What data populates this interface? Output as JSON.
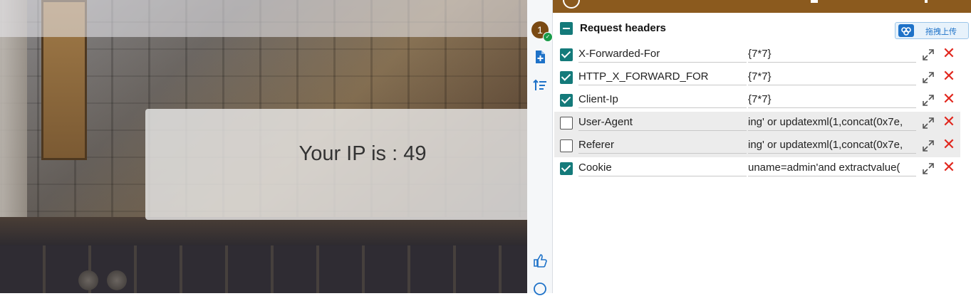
{
  "webpage": {
    "ip_text": "Your IP is : 49"
  },
  "icon_strip": {
    "profile_number": "1"
  },
  "panel": {
    "section_title": "Request headers",
    "upload_button_label": "拖拽上传",
    "headers": [
      {
        "name": "X-Forwarded-For",
        "value": "{7*7}",
        "enabled": true
      },
      {
        "name": "HTTP_X_FORWARD_FOR",
        "value": "{7*7}",
        "enabled": true
      },
      {
        "name": "Client-Ip",
        "value": "{7*7}",
        "enabled": true
      },
      {
        "name": "User-Agent",
        "value": "ing' or updatexml(1,concat(0x7e,",
        "enabled": false
      },
      {
        "name": "Referer",
        "value": "ing' or updatexml(1,concat(0x7e,",
        "enabled": false
      },
      {
        "name": "Cookie",
        "value": "uname=admin'and extractvalue(",
        "enabled": true
      }
    ]
  },
  "colors": {
    "panel_header": "#8b5a1e",
    "checkbox_on": "#147a7a",
    "delete": "#e1271e",
    "accent_blue": "#1e72c8"
  }
}
